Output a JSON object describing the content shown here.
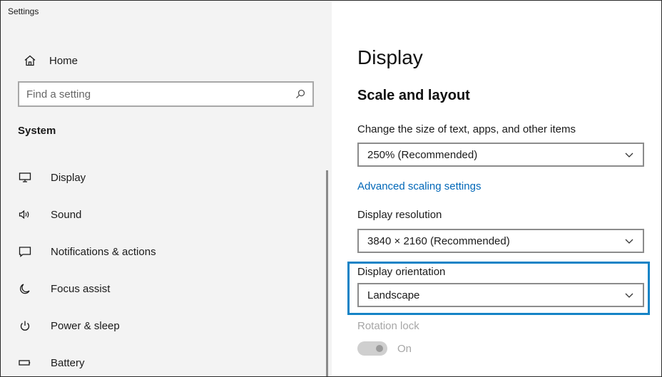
{
  "window": {
    "title": "Settings"
  },
  "sidebar": {
    "home_label": "Home",
    "search": {
      "placeholder": "Find a setting",
      "value": ""
    },
    "section_heading": "System",
    "items": [
      {
        "label": "Display",
        "icon": "monitor-icon"
      },
      {
        "label": "Sound",
        "icon": "speaker-icon"
      },
      {
        "label": "Notifications & actions",
        "icon": "notification-icon"
      },
      {
        "label": "Focus assist",
        "icon": "moon-icon"
      },
      {
        "label": "Power & sleep",
        "icon": "power-icon"
      },
      {
        "label": "Battery",
        "icon": "battery-icon"
      }
    ]
  },
  "main": {
    "title": "Display",
    "section_title": "Scale and layout",
    "scale": {
      "label": "Change the size of text, apps, and other items",
      "value": "250% (Recommended)"
    },
    "advanced_link": "Advanced scaling settings",
    "resolution": {
      "label": "Display resolution",
      "value": "3840 × 2160 (Recommended)"
    },
    "orientation": {
      "label": "Display orientation",
      "value": "Landscape"
    },
    "rotation_lock": {
      "label": "Rotation lock",
      "state_text": "On",
      "enabled": false,
      "on": true
    }
  },
  "colors": {
    "sidebar_bg": "#f3f3f3",
    "link": "#0067b8",
    "highlight_border": "#1583c6",
    "disabled_text": "#a6a6a6"
  }
}
